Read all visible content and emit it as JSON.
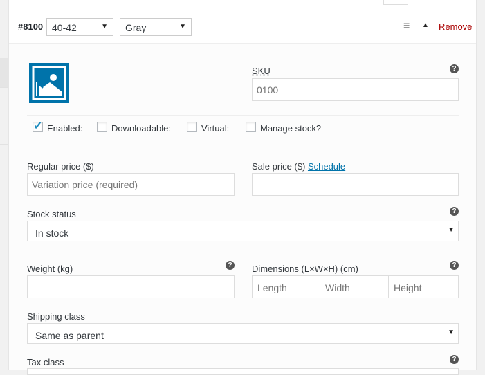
{
  "variation": {
    "id": "#8100",
    "size_value": "40-42",
    "color_value": "Gray",
    "remove_label": "Remove",
    "menu_icon": "menu-icon",
    "toggle_icon": "caret-up-icon"
  },
  "image": {
    "icon": "image-placeholder-icon",
    "color": "#0073aa"
  },
  "sku": {
    "label": "SKU",
    "placeholder": "0100"
  },
  "options": {
    "enabled": {
      "label": "Enabled:",
      "checked": true
    },
    "downloadable": {
      "label": "Downloadable:",
      "checked": false
    },
    "virtual": {
      "label": "Virtual:",
      "checked": false
    },
    "manage_stock": {
      "label": "Manage stock?",
      "checked": false
    }
  },
  "pricing": {
    "regular_label": "Regular price ($)",
    "regular_placeholder": "Variation price (required)",
    "sale_label": "Sale price ($)",
    "schedule_label": "Schedule"
  },
  "stock": {
    "label": "Stock status",
    "value": "In stock"
  },
  "weight": {
    "label": "Weight (kg)"
  },
  "dimensions": {
    "label": "Dimensions (L×W×H) (cm)",
    "length_placeholder": "Length",
    "width_placeholder": "Width",
    "height_placeholder": "Height"
  },
  "shipping": {
    "label": "Shipping class",
    "value": "Same as parent"
  },
  "tax": {
    "label": "Tax class"
  },
  "help_glyph": "?"
}
